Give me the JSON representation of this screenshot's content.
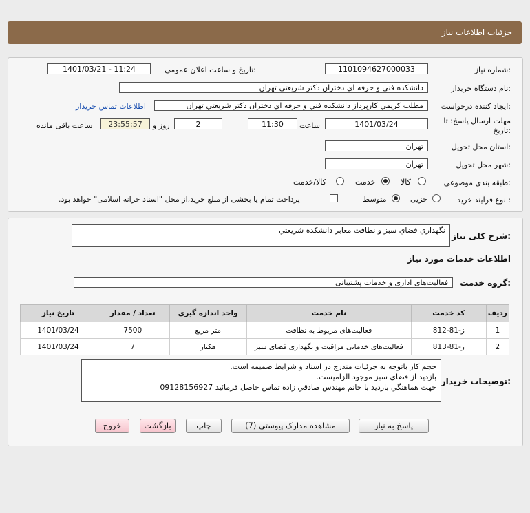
{
  "header": {
    "title": "جزئیات اطلاعات نیاز"
  },
  "form": {
    "need_number": {
      "label": "شماره نیاز:",
      "value": "1101094627000033"
    },
    "announce_datetime": {
      "label": "تاریخ و ساعت اعلان عمومی:",
      "value": "1401/03/21 - 11:24"
    },
    "buyer_org": {
      "label": "نام دستگاه خریدار:",
      "value": "دانشكده فني و حرفه اي دختران دكتر شريعتي تهران"
    },
    "creator": {
      "label": "ایجاد کننده درخواست:",
      "value": "مطلب كريمي كارپرداز دانشكده فني و حرفه اي دختران دكتر شريعتي تهران",
      "contact_link": "اطلاعات تماس خریدار"
    },
    "deadline": {
      "label_line1": "مهلت ارسال پاسخ: تا",
      "label_line2": "تاریخ:",
      "date": "1401/03/24",
      "time_label": "ساعت",
      "time": "11:30",
      "days": "2",
      "days_label": "روز و",
      "remaining": "23:55:57",
      "remaining_label": "ساعت باقی مانده"
    },
    "delivery_province": {
      "label": "استان محل تحویل:",
      "value": "تهران"
    },
    "delivery_city": {
      "label": "شهر محل تحویل:",
      "value": "تهران"
    },
    "category": {
      "label": "طبقه بندی موضوعی:",
      "options": [
        "کالا",
        "خدمت",
        "کالا/خدمت"
      ],
      "selected": 1
    },
    "process_type": {
      "label": "نوع فرآیند خرید :",
      "options": [
        "جزیی",
        "متوسط"
      ],
      "selected": 1,
      "payment_note": "پرداخت تمام یا بخشی از مبلغ خرید،از محل \"اسناد خزانه اسلامی\" خواهد بود."
    }
  },
  "need_summary": {
    "label": "شرح کلی نیاز:",
    "value": "نگهداري فضاي سبز و نظافت معابر دانشكده شريعتي"
  },
  "services_section_title": "اطلاعات خدمات مورد نیاز",
  "service_group": {
    "label": "گروه خدمت:",
    "value": "فعالیت‌های اداری و خدمات پشتیبانی"
  },
  "table": {
    "headers": [
      "ردیف",
      "کد خدمت",
      "نام خدمت",
      "واحد اندازه گیری",
      "تعداد / مقدار",
      "تاریخ نیاز"
    ],
    "rows": [
      [
        "1",
        "ز-81-812",
        "فعالیت‌های مربوط به نظافت",
        "متر مربع",
        "7500",
        "1401/03/24"
      ],
      [
        "2",
        "ز-81-813",
        "فعالیت‌های خدماتی مراقبت و نگهداری فضای سبز",
        "هکتار",
        "7",
        "1401/03/24"
      ]
    ]
  },
  "buyer_notes": {
    "label": "توضیحات خریدار:",
    "lines": [
      "حجم كار باتوجه به جزئيات مندرج در اسناد و شرايط ضميمه است.",
      "بازديد از فضاي سبز موجود الزاميست.",
      "جهت هماهنگي بازديد با خانم مهندس صادقي زاده تماس حاصل فرمائيد 09128156927"
    ]
  },
  "buttons": {
    "reply": "پاسخ به نیاز",
    "view_docs": "مشاهده مدارک پیوستی (7)",
    "print": "چاپ",
    "back": "بازگشت",
    "exit": "خروج"
  }
}
